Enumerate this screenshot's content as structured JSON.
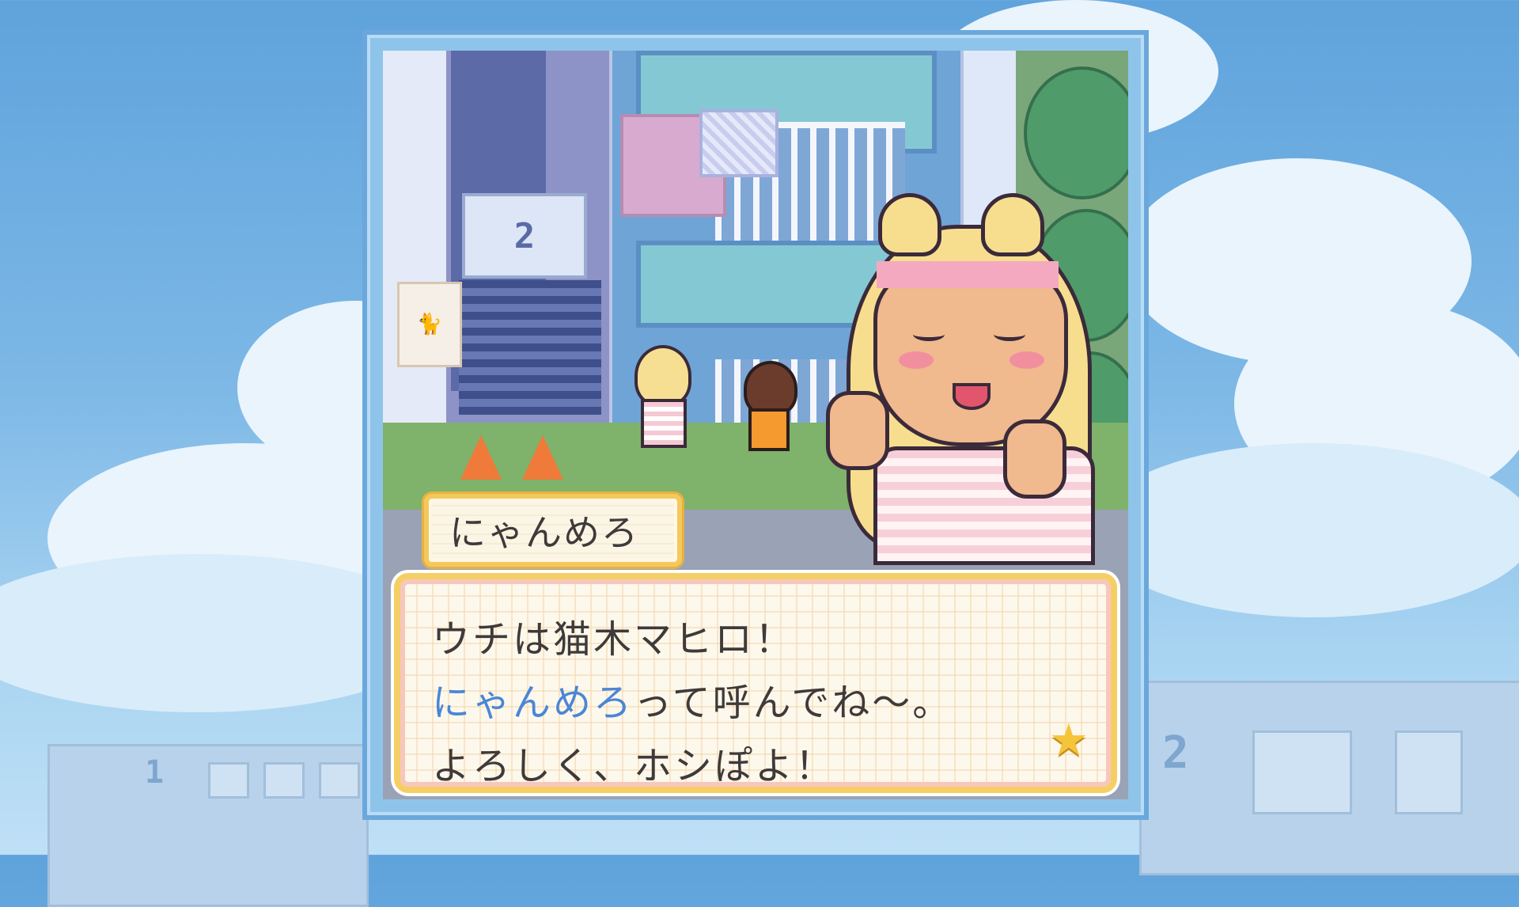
{
  "scene": {
    "apartment_number": "2",
    "background_building_numbers": [
      "1",
      "2"
    ]
  },
  "dialogue": {
    "speaker_name": "にゃんめろ",
    "lines": [
      {
        "text": "ウチは猫木マヒロ！"
      },
      {
        "highlight": "にゃんめろ",
        "text": "って呼んでね～。"
      },
      {
        "text": "よろしく、ホシぽよ！"
      }
    ],
    "highlight_color": "#4b86d6",
    "advance_icon": "star-icon"
  },
  "colors": {
    "frame": "#6aa8dc",
    "name_box_border": "#f3c95e",
    "dialogue_border": "#f5cf64",
    "text": "#3f3a3a"
  }
}
